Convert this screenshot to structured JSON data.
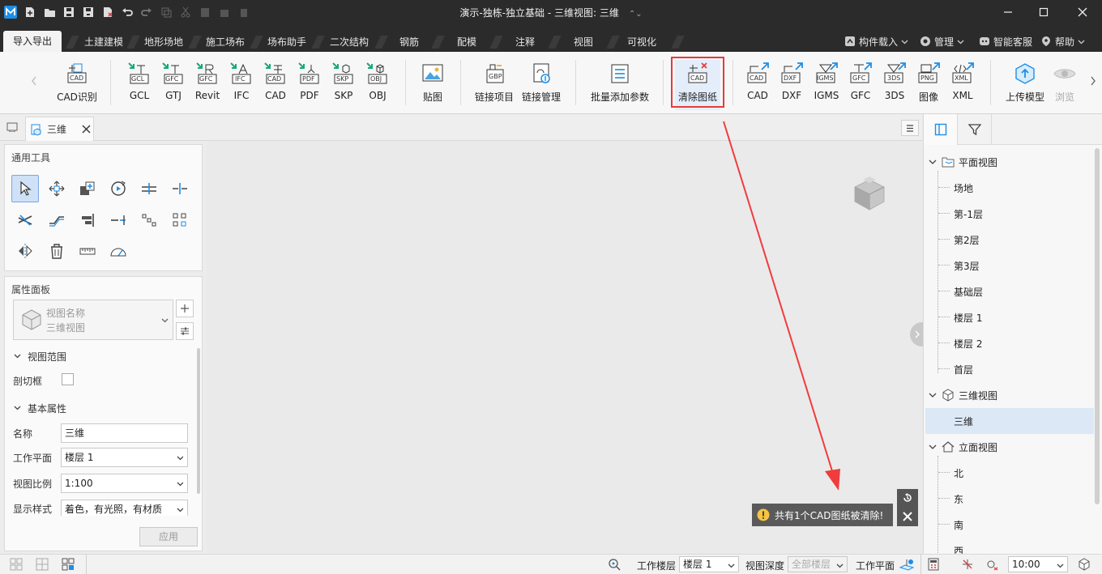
{
  "window": {
    "title": "演示-独栋-独立基础 - 三维视图: 三维",
    "title_caret": "⌃⌄"
  },
  "ribbon_tabs": [
    "导入导出",
    "土建建模",
    "地形场地",
    "施工场布",
    "场布助手",
    "二次结构",
    "钢筋",
    "配模",
    "注释",
    "视图",
    "可视化"
  ],
  "tab_right": {
    "component_load": "构件载入",
    "manage": "管理",
    "support": "智能客服",
    "help": "帮助"
  },
  "ribbon_buttons": {
    "cad_recognize": "CAD识别",
    "gcl": "GCL",
    "gtj": "GTJ",
    "revit": "Revit",
    "ifc": "IFC",
    "cad": "CAD",
    "pdf": "PDF",
    "skp": "SKP",
    "obj": "OBJ",
    "paste_image": "贴图",
    "link_project": "链接项目",
    "link_manage": "链接管理",
    "batch_params": "批量添加参数",
    "clear_drawings": "清除图纸",
    "export_cad": "CAD",
    "export_dxf": "DXF",
    "export_igms": "IGMS",
    "export_gfc": "GFC",
    "export_3ds": "3DS",
    "export_png": "图像",
    "export_xml": "XML",
    "upload_model": "上传模型",
    "browse": "浏览"
  },
  "icon_text": {
    "cad": "CAD",
    "gcl": "GCL",
    "gfc": "GFC",
    "ifc": "IFC",
    "pdf": "PDF",
    "skp": "SKP",
    "obj": "OBJ",
    "gbp": "GBP",
    "dxf": "DXF",
    "igms": "IGMS",
    "3ds": "3DS",
    "png": "PNG",
    "xml": "XML"
  },
  "doc_tab": {
    "label": "三维"
  },
  "tools_panel": {
    "title": "通用工具"
  },
  "property_panel": {
    "title": "属性面板",
    "view_name_label": "视图名称",
    "view_type": "三维视图",
    "section_view_range": "视图范围",
    "section_box_label": "剖切框",
    "section_basic": "基本属性",
    "name_label": "名称",
    "name_value": "三维",
    "work_plane_label": "工作平面",
    "work_plane_value": "楼层 1",
    "scale_label": "视图比例",
    "scale_value": "1:100",
    "display_label": "显示样式",
    "display_value": "着色，有光照，有材质",
    "apply_button": "应用"
  },
  "toast": {
    "message": "共有1个CAD图纸被清除!"
  },
  "tree": {
    "plan": {
      "label": "平面视图",
      "children": [
        "场地",
        "第-1层",
        "第2层",
        "第3层",
        "基础层",
        "楼层 1",
        "楼层 2",
        "首层"
      ]
    },
    "threed": {
      "label": "三维视图",
      "children": [
        "三维"
      ]
    },
    "elevation": {
      "label": "立面视图",
      "children": [
        "北",
        "东",
        "南",
        "西"
      ]
    }
  },
  "statusbar": {
    "work_floor_label": "工作楼层",
    "work_floor_value": "楼层 1",
    "view_depth_label": "视图深度",
    "view_depth_value": "全部楼层",
    "work_plane_label": "工作平面",
    "time_value": "10:00"
  },
  "colors": {
    "titlebar": "#2b2b2b",
    "highlight_red": "#e83a3a",
    "accent_blue": "#1e8ee6",
    "arrow_red": "#f03c3c"
  }
}
